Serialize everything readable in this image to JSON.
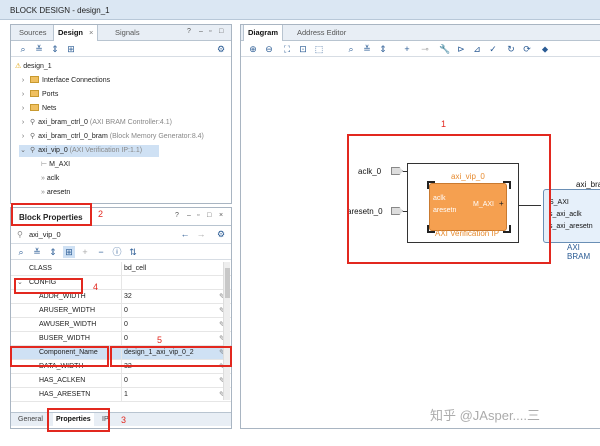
{
  "window": {
    "title": "BLOCK DESIGN - design_1"
  },
  "left_top_tabs": {
    "sources": "Sources",
    "design": "Design",
    "signals": "Signals",
    "close": "×",
    "help": "?"
  },
  "tree": {
    "root": "design_1",
    "items": [
      {
        "label": "Interface Connections"
      },
      {
        "label": "Ports"
      },
      {
        "label": "Nets"
      },
      {
        "label": "axi_bram_ctrl_0",
        "detail": "(AXI BRAM Controller:4.1)"
      },
      {
        "label": "axi_bram_ctrl_0_bram",
        "detail": "(Block Memory Generator:8.4)"
      },
      {
        "label": "axi_vip_0",
        "detail": "(AXI Verification IP:1.1)"
      }
    ],
    "children": [
      "M_AXI",
      "aclk",
      "aresetn"
    ]
  },
  "block_props": {
    "title": "Block Properties",
    "instance": "axi_vip_0",
    "rows": [
      {
        "k": "CLASS",
        "v": "bd_cell"
      },
      {
        "k": "CONFIG",
        "v": ""
      },
      {
        "k": "ADDR_WIDTH",
        "v": "32"
      },
      {
        "k": "ARUSER_WIDTH",
        "v": "0"
      },
      {
        "k": "AWUSER_WIDTH",
        "v": "0"
      },
      {
        "k": "BUSER_WIDTH",
        "v": "0"
      },
      {
        "k": "Component_Name",
        "v": "design_1_axi_vip_0_2"
      },
      {
        "k": "DATA_WIDTH",
        "v": "32"
      },
      {
        "k": "HAS_ACLKEN",
        "v": "0"
      },
      {
        "k": "HAS_ARESETN",
        "v": "1"
      }
    ],
    "tabs": [
      "General",
      "Properties",
      "IP"
    ]
  },
  "diagram": {
    "tabs": [
      "Diagram",
      "Address Editor"
    ],
    "block_title": "axi_vip_0",
    "block_sub": "AXI Verification IP",
    "port_aclk": "aclk",
    "port_aresetn": "aresetn",
    "port_maxi": "M_AXI",
    "ext_aclk": "aclk_0",
    "ext_aresetn": "aresetn_0",
    "right_block_title": "axi_bra",
    "right_ports": [
      "S_AXI",
      "s_axi_aclk",
      "s_axi_aresetn"
    ],
    "right_sub": "AXI BRAM"
  },
  "annotations": [
    "1",
    "2",
    "3",
    "4",
    "5"
  ],
  "watermark": "知乎 @JAsper....三",
  "colors": {
    "accent_red": "#e2281f",
    "vip_orange": "#f5a050",
    "header_blue": "#dbe7f3"
  }
}
